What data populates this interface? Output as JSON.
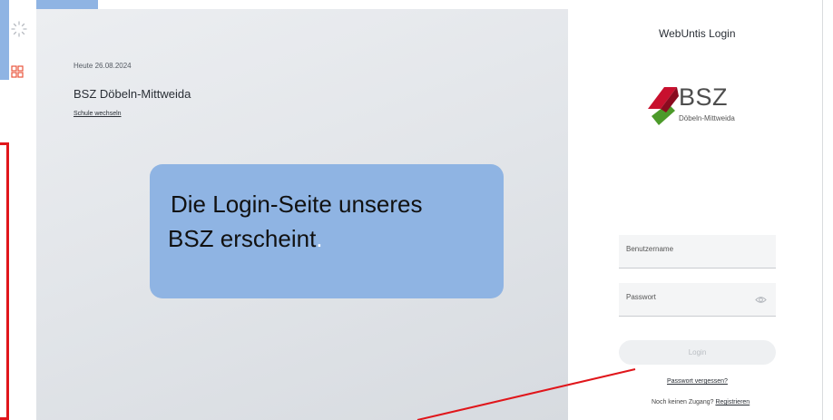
{
  "icons": {
    "spinner": "loading-spinner-icon",
    "apps": "apps-icon",
    "eye": "eye-icon"
  },
  "colors": {
    "callout_bg": "#8fb4e3",
    "annotation_red": "#e0161b",
    "logo_red": "#c8102e",
    "logo_green": "#4c9a2a"
  },
  "left": {
    "today": "Heute 26.08.2024",
    "school_name": "BSZ Döbeln-Mittweida",
    "switch_school": "Schule wechseln"
  },
  "callout": {
    "line1": "Die Login-Seite unseres",
    "line2": "BSZ erscheint",
    "line2_end": "."
  },
  "login": {
    "title": "WebUntis Login",
    "logo_text": "BSZ",
    "logo_sub": "Döbeln-Mittweida",
    "username_placeholder": "Benutzername",
    "password_placeholder": "Passwort",
    "login_button": "Login",
    "forgot_password": "Passwort vergessen?",
    "no_access": "Noch keinen Zugang?",
    "register": "Registrieren"
  }
}
